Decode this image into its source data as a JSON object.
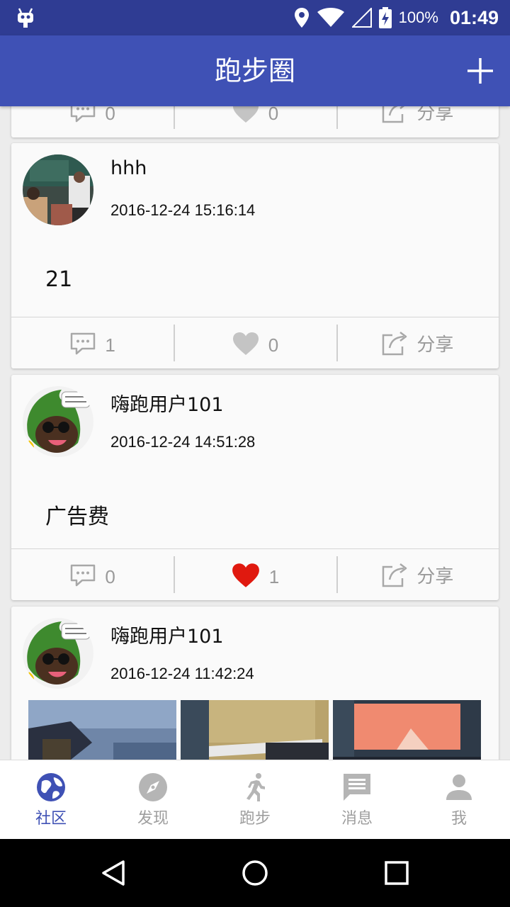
{
  "app": {
    "title": "跑步圈"
  },
  "status_bar": {
    "battery": "100%",
    "time": "01:49"
  },
  "posts": [
    {
      "comments": "0",
      "likes": "0",
      "share_label": "分享",
      "liked": false
    },
    {
      "username": "hhh",
      "time": "2016-12-24 15:16:14",
      "content": "21",
      "comments": "1",
      "likes": "0",
      "share_label": "分享",
      "liked": false
    },
    {
      "username": "嗨跑用户101",
      "time": "2016-12-24 14:51:28",
      "content": "广告费",
      "comments": "0",
      "likes": "1",
      "share_label": "分享",
      "liked": true
    },
    {
      "username": "嗨跑用户101",
      "time": "2016-12-24 11:42:24"
    }
  ],
  "bottom_nav": [
    {
      "label": "社区",
      "icon": "globe-icon",
      "active": true
    },
    {
      "label": "发现",
      "icon": "compass-icon",
      "active": false
    },
    {
      "label": "跑步",
      "icon": "runner-icon",
      "active": false
    },
    {
      "label": "消息",
      "icon": "message-icon",
      "active": false
    },
    {
      "label": "我",
      "icon": "person-icon",
      "active": false
    }
  ],
  "colors": {
    "primary": "#3f51b5",
    "primary_dark": "#2f3c93",
    "like_active": "#e0190f",
    "inactive": "#9e9e9e"
  }
}
